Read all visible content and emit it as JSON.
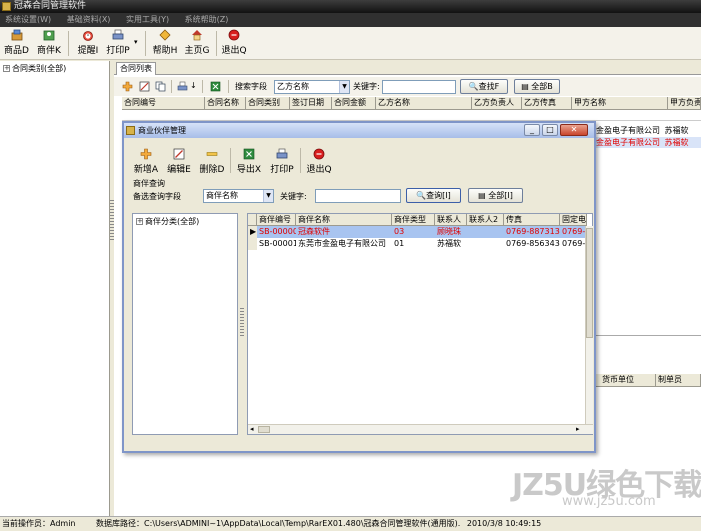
{
  "app": {
    "title": "冠森合同管理软件"
  },
  "menu": [
    "系统设置(W)",
    "基础资料(X)",
    "实用工具(Y)",
    "系统帮助(Z)"
  ],
  "toolbar": {
    "buttons": [
      "商品D",
      "商伴K",
      "提醒I",
      "打印P",
      "帮助H",
      "主页G",
      "退出Q"
    ]
  },
  "left_tree": {
    "root": "合同类别(全部)"
  },
  "main": {
    "tab": "合同列表",
    "search_field_label": "搜索字段",
    "search_field_value": "乙方名称",
    "keyword_label": "关键字:",
    "keyword_value": "",
    "find_button": "查找F",
    "all_button": "全部B",
    "columns": [
      "合同编号",
      "合同名称",
      "合同类别",
      "签订日期",
      "合同金额",
      "乙方名称",
      "乙方负责人",
      "乙方传真",
      "甲方名称",
      "甲方负责"
    ],
    "visible_fragments": [
      {
        "text": "金盈电子有限公司",
        "extra": "苏福软",
        "highlight": false
      },
      {
        "text": "金盈电子有限公司",
        "extra": "苏福软",
        "highlight": true
      }
    ],
    "lower_headers": [
      "货币单位",
      "制单员"
    ]
  },
  "dialog": {
    "title": "商业伙伴管理",
    "buttons": [
      "新增A",
      "编辑E",
      "删除D",
      "导出X",
      "打印P",
      "退出Q"
    ],
    "query_group_label": "商伴查询",
    "query_field_label": "备选查询字段",
    "query_field_value": "商伴名称",
    "keyword_label": "关键字:",
    "keyword_value": "",
    "query_button": "查询[I]",
    "all_button": "全部[I]",
    "tree_root": "商伴分类(全部)",
    "columns": [
      "商伴编号",
      "商伴名称",
      "商伴类型",
      "联系人",
      "联系人2",
      "传真",
      "固定电"
    ],
    "rows": [
      {
        "id": "SB-00000",
        "name": "冠森软件",
        "type": "03",
        "contact": "顾晓珠",
        "contact2": "",
        "fax": "0769-88731322",
        "phone": "0769-8",
        "selected": true
      },
      {
        "id": "SB-00001",
        "name": "东莞市金盈电子有限公司",
        "type": "01",
        "contact": "苏福软",
        "contact2": "",
        "fax": "0769-85634390",
        "phone": "0769-8",
        "selected": false
      }
    ]
  },
  "status": {
    "operator": "当前操作员：Admin",
    "db_path": "数据库路径：C:\\Users\\ADMINI~1\\AppData\\Local\\Temp\\RarEX01.480\\冠森合同管理软件(通用版).",
    "datetime": "2010/3/8 10:49:15"
  },
  "watermark": {
    "main": "JZ5U绿色下载",
    "sub": "www.jz5u.com"
  },
  "colors": {
    "accent": "#316ac5",
    "selected_row": "#a8c4f0",
    "red_text": "#e00000"
  }
}
